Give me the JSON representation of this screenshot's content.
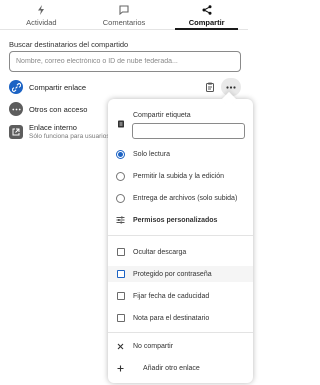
{
  "tabs": [
    {
      "label": "Actividad",
      "icon": "bolt-icon"
    },
    {
      "label": "Comentarios",
      "icon": "comment-icon"
    },
    {
      "label": "Compartir",
      "icon": "share-icon",
      "active": true
    }
  ],
  "search": {
    "label": "Buscar destinatarios del compartido",
    "placeholder": "Nombre, correo electrónico o ID de nube federada..."
  },
  "shares": [
    {
      "label": "Compartir enlace",
      "icon": "link-icon",
      "color": "#1c63c4"
    },
    {
      "label": "Otros con acceso",
      "icon": "dots-icon",
      "color": "#5d5d5d"
    },
    {
      "label": "Enlace interno",
      "sublabel": "Sólo funciona para usuarios",
      "icon": "external-link-icon",
      "color": "#5d5d5d"
    }
  ],
  "menu": {
    "share_label_title": "Compartir etiqueta",
    "share_label_value": "",
    "permissions": [
      {
        "label": "Solo lectura",
        "selected": true
      },
      {
        "label": "Permitir la subida y la edición",
        "selected": false
      },
      {
        "label": "Entrega de archivos (solo subida)",
        "selected": false
      }
    ],
    "custom_permissions": "Permisos personalizados",
    "options": [
      {
        "label": "Ocultar descarga",
        "checked": false
      },
      {
        "label": "Protegido por contraseña",
        "checked": false
      },
      {
        "label": "Fijar fecha de caducidad",
        "checked": false
      },
      {
        "label": "Nota para el destinatario",
        "checked": false
      }
    ],
    "unshare": "No compartir",
    "add_link": "Añadir otro enlace"
  },
  "colors": {
    "accent": "#1c63c4"
  }
}
